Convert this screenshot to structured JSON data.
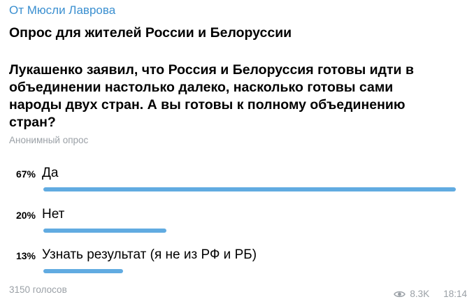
{
  "message": {
    "forward_prefix": "От",
    "forward_author": "Мюсли Лаврова",
    "poll_title": "Опрос для жителей России и Белоруссии",
    "question_lines": [
      "Лукашенко заявил, что Россия и Белоруссия готовы идти в",
      "объединении настолько далеко, насколько готовы сами",
      "народы двух стран. А вы готовы к полному объединению",
      "стран?"
    ],
    "poll_type": "Анонимный опрос",
    "options": [
      {
        "percent_label": "67%",
        "text": "Да",
        "fraction": 0.67
      },
      {
        "percent_label": "20%",
        "text": "Нет",
        "fraction": 0.2
      },
      {
        "percent_label": "13%",
        "text": "Узнать результат (я не из РФ и РБ)",
        "fraction": 0.13
      }
    ],
    "votes": "3150 голосов",
    "views": "8.3K",
    "time": "18:14"
  },
  "colors": {
    "accent": "#3a8fd0",
    "bar": "#61abe1",
    "muted": "#9aa0a6"
  },
  "icons": {
    "views": "eye-icon"
  }
}
